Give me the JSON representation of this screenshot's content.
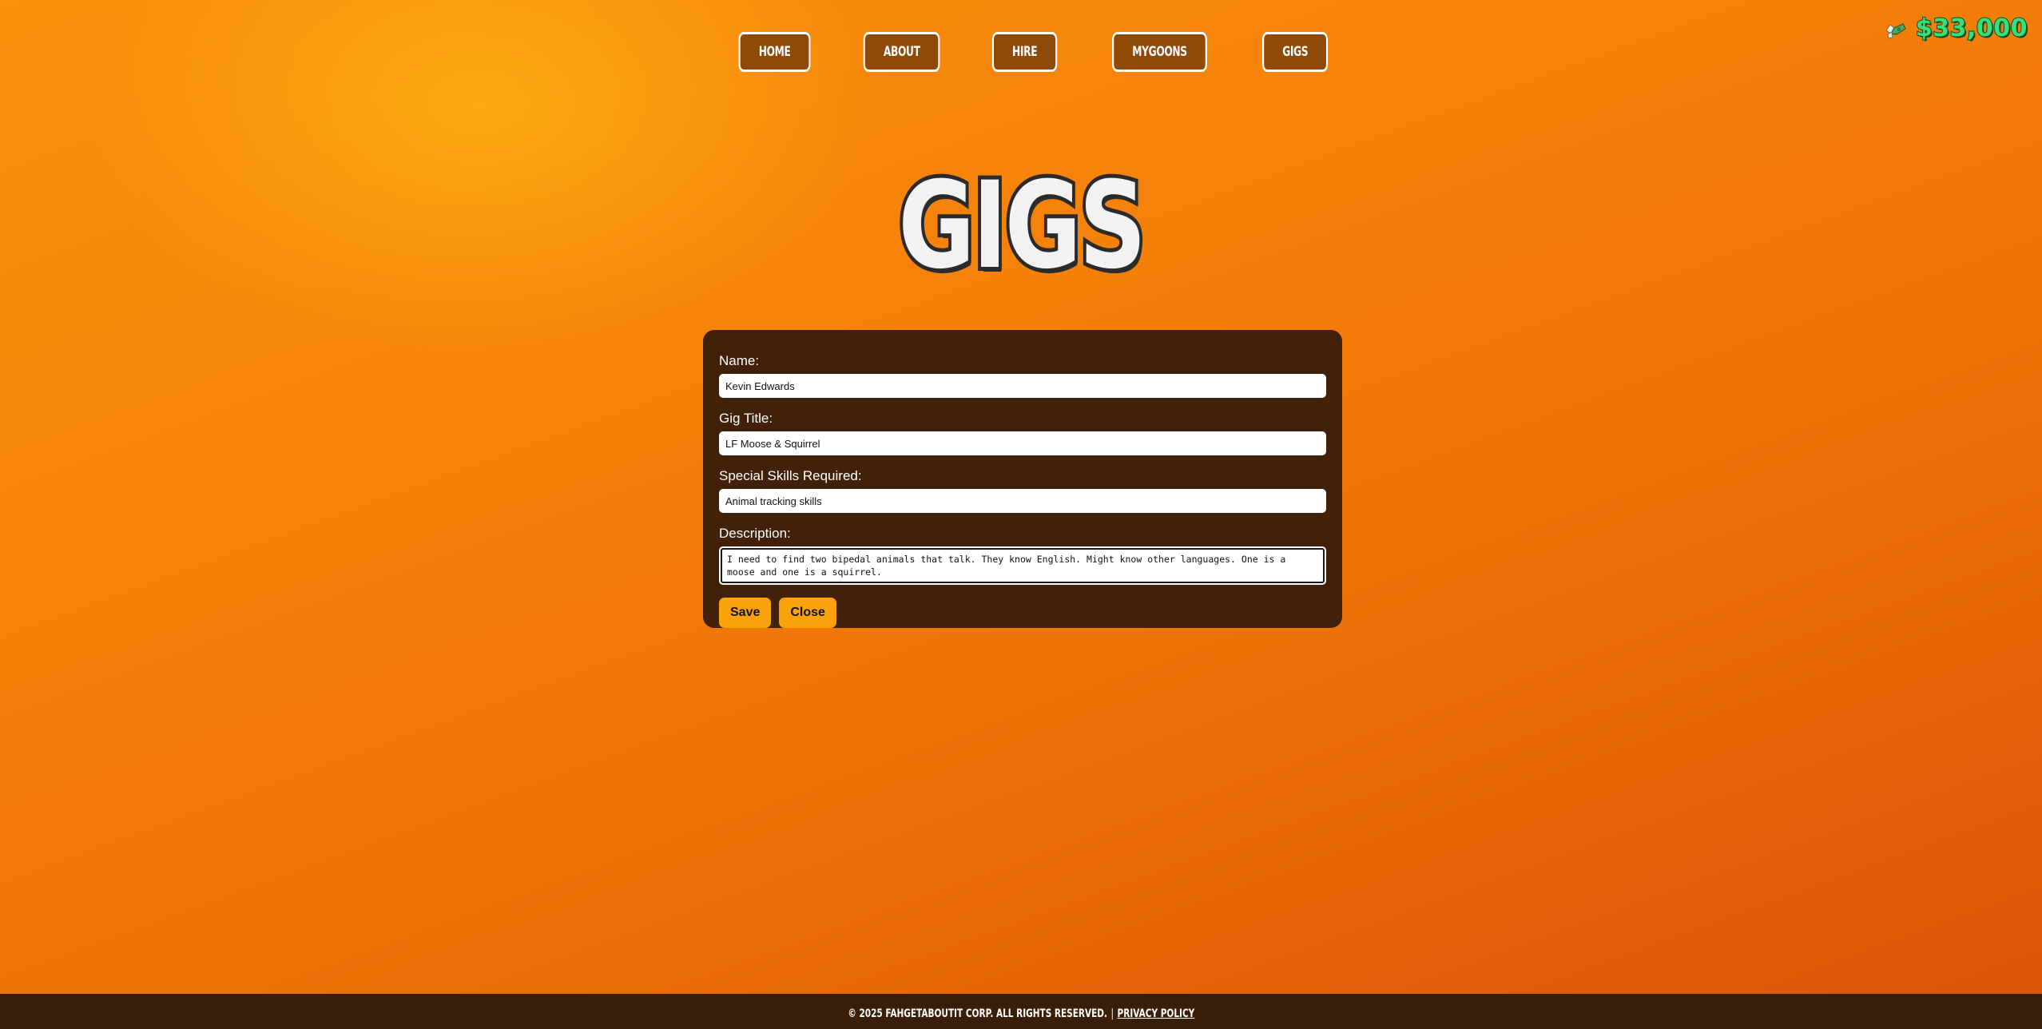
{
  "nav": {
    "items": [
      {
        "label": "HOME"
      },
      {
        "label": "ABOUT"
      },
      {
        "label": "HIRE"
      },
      {
        "label": "MYGOONS"
      },
      {
        "label": "GIGS"
      }
    ]
  },
  "wallet": {
    "icon": "money-with-wings-icon",
    "amount": "$33,000"
  },
  "page": {
    "title": "GIGS"
  },
  "form": {
    "name_label": "Name:",
    "name_value": "Kevin Edwards",
    "gig_title_label": "Gig Title:",
    "gig_title_value": "LF Moose & Squirrel",
    "skills_label": "Special Skills Required:",
    "skills_value": "Animal tracking skills",
    "description_label": "Description:",
    "description_value": "I need to find two bipedal animals that talk. They know English. Might know other languages. One is a moose and one is a squirrel.",
    "save_label": "Save",
    "close_label": "Close"
  },
  "footer": {
    "copyright": "© 2025 FAHGETABOUTIT CORP. ALL RIGHTS RESERVED.",
    "separator": "|",
    "privacy_label": "PRIVACY POLICY"
  },
  "colors": {
    "background_top": "#f98f0b",
    "background_bottom": "#d95307",
    "nav_button_bg": "#8f4a07",
    "card_bg": "#42210a",
    "button_accent": "#f9a20b",
    "money_green": "#37e07a",
    "footer_bg": "#3a1e07"
  }
}
